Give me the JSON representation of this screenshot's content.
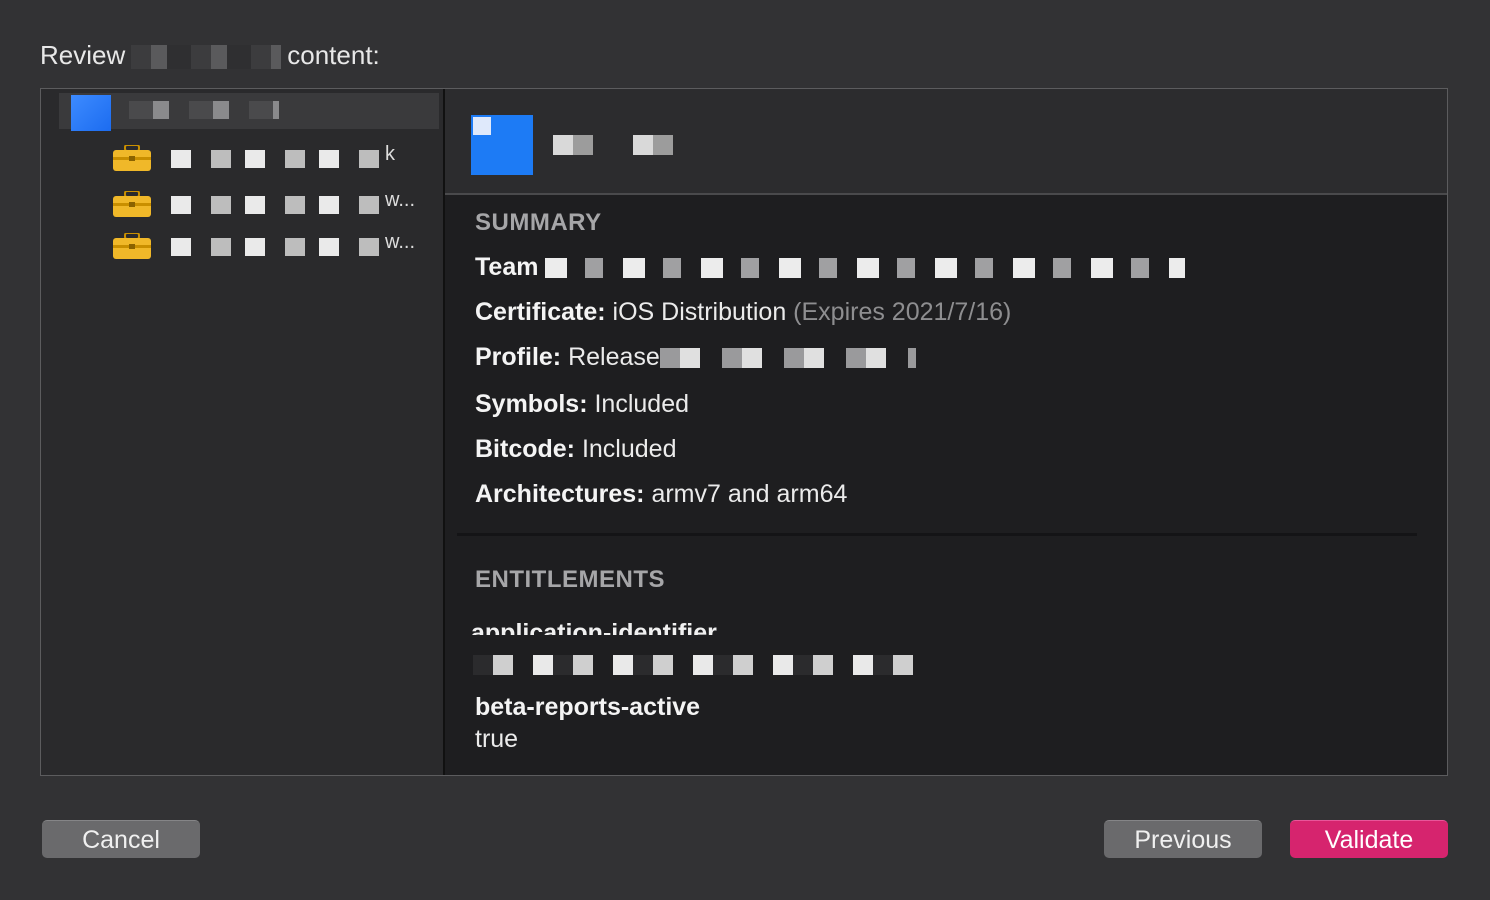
{
  "dialog": {
    "title_prefix": "Review",
    "title_suffix": "content:"
  },
  "sidebar": {
    "items": [
      {
        "tail": "k"
      },
      {
        "tail": "w..."
      },
      {
        "tail": "w..."
      }
    ]
  },
  "summary": {
    "section_title": "SUMMARY",
    "team_label": "Team",
    "certificate_label": "Certificate:",
    "certificate_value": "iOS Distribution",
    "certificate_expiry": "(Expires 2021/7/16)",
    "profile_label": "Profile:",
    "profile_value": "Release",
    "symbols_label": "Symbols:",
    "symbols_value": "Included",
    "bitcode_label": "Bitcode:",
    "bitcode_value": "Included",
    "architectures_label": "Architectures:",
    "architectures_value": "armv7 and arm64"
  },
  "entitlements": {
    "section_title": "ENTITLEMENTS",
    "app_id_key": "application-identifier",
    "beta_key": "beta-reports-active",
    "beta_value": "true"
  },
  "buttons": {
    "cancel": "Cancel",
    "previous": "Previous",
    "validate": "Validate"
  },
  "colors": {
    "accent": "#d6246e",
    "background": "#323234",
    "panel": "#1e1e20"
  }
}
